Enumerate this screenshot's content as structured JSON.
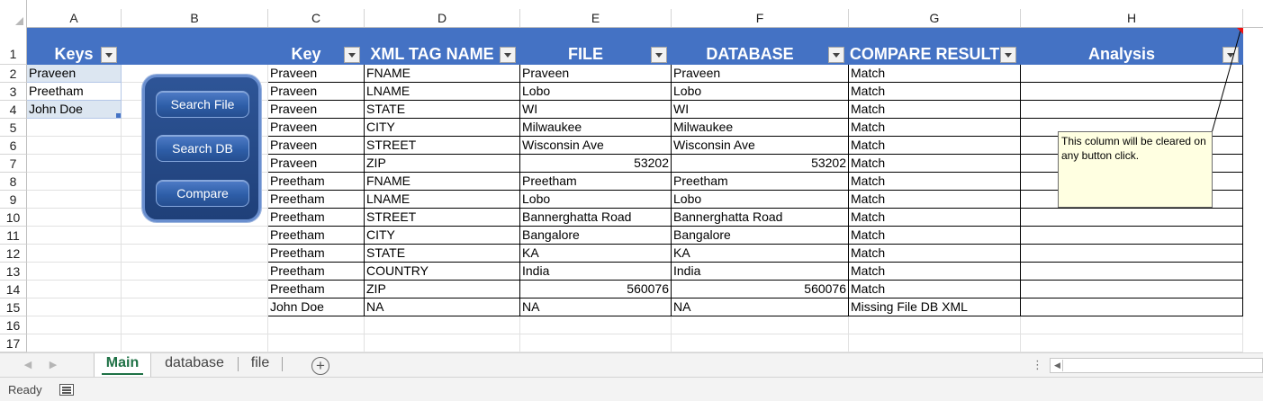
{
  "columns": [
    "A",
    "B",
    "C",
    "D",
    "E",
    "F",
    "G",
    "H"
  ],
  "rows": [
    "1",
    "2",
    "3",
    "4",
    "5",
    "6",
    "7",
    "8",
    "9",
    "10",
    "11",
    "12",
    "13",
    "14",
    "15",
    "16",
    "17"
  ],
  "keys_table": {
    "header": "Keys",
    "values": [
      "Praveen",
      "Preetham",
      "John Doe"
    ]
  },
  "buttons": {
    "search_file": "Search File",
    "search_db": "Search DB",
    "compare": "Compare"
  },
  "main_table": {
    "headers": [
      "Key",
      "XML TAG NAME",
      "FILE",
      "DATABASE",
      "COMPARE RESULT",
      "Analysis"
    ],
    "rows": [
      [
        "Praveen",
        "FNAME",
        "Praveen",
        "Praveen",
        "Match",
        ""
      ],
      [
        "Praveen",
        "LNAME",
        "Lobo",
        "Lobo",
        "Match",
        ""
      ],
      [
        "Praveen",
        "STATE",
        "WI",
        "WI",
        "Match",
        ""
      ],
      [
        "Praveen",
        "CITY",
        "Milwaukee",
        "Milwaukee",
        "Match",
        ""
      ],
      [
        "Praveen",
        "STREET",
        "Wisconsin Ave",
        "Wisconsin Ave",
        "Match",
        ""
      ],
      [
        "Praveen",
        "ZIP",
        "53202",
        "53202",
        "Match",
        ""
      ],
      [
        "Preetham",
        "FNAME",
        "Preetham",
        "Preetham",
        "Match",
        ""
      ],
      [
        "Preetham",
        "LNAME",
        "Lobo",
        "Lobo",
        "Match",
        ""
      ],
      [
        "Preetham",
        "STREET",
        "Bannerghatta Road",
        "Bannerghatta Road",
        "Match",
        ""
      ],
      [
        "Preetham",
        "CITY",
        "Bangalore",
        "Bangalore",
        "Match",
        ""
      ],
      [
        "Preetham",
        "STATE",
        "KA",
        "KA",
        "Match",
        ""
      ],
      [
        "Preetham",
        "COUNTRY",
        "India",
        "India",
        "Match",
        ""
      ],
      [
        "Preetham",
        "ZIP",
        "560076",
        "560076",
        "Match",
        ""
      ],
      [
        "John Doe",
        "NA",
        "NA",
        "NA",
        "Missing File DB XML",
        ""
      ]
    ]
  },
  "comment": {
    "text": "This column will be cleared on any button click."
  },
  "sheet_tabs": [
    "Main",
    "database",
    "file"
  ],
  "active_tab": "Main",
  "status": "Ready",
  "colors": {
    "table_header": "#4472c4",
    "keys_fill": "#dce6f1",
    "active_tab": "#1e7145",
    "button_panel": "#2e5597",
    "note_fill": "#ffffe1"
  }
}
